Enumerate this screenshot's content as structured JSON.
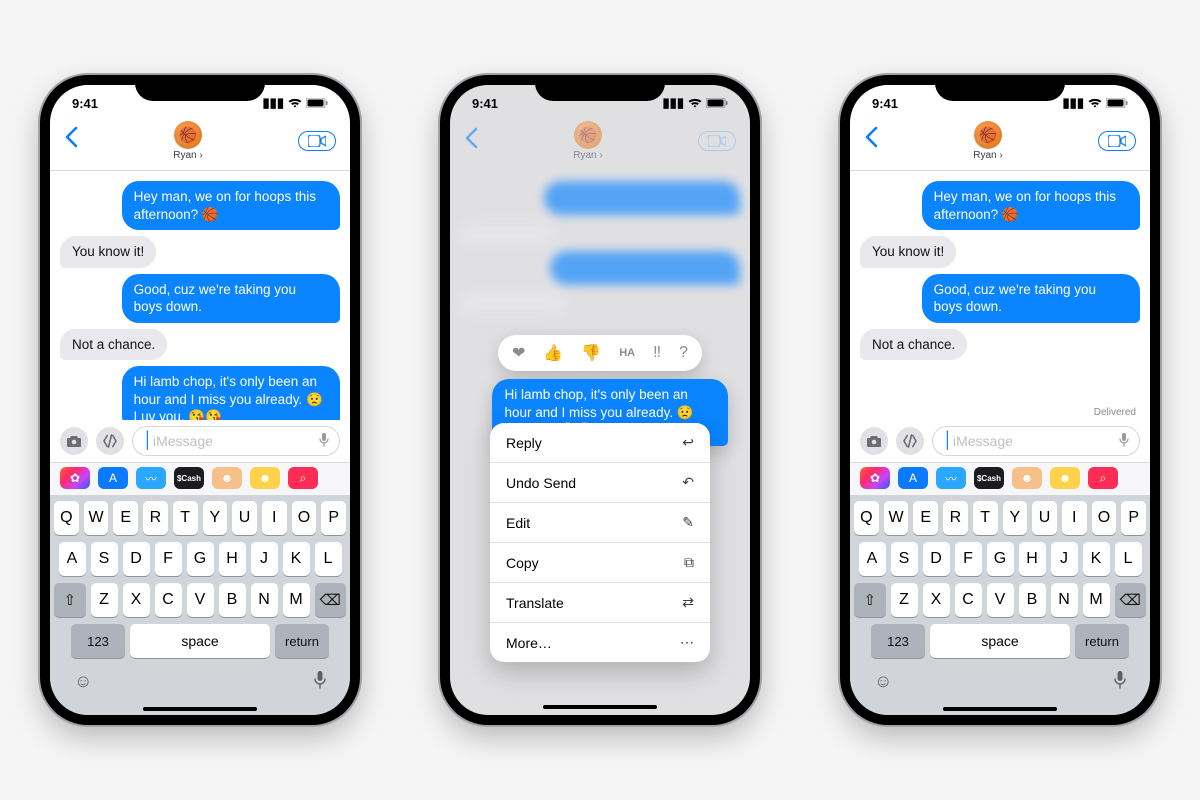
{
  "status": {
    "time": "9:41"
  },
  "contact": {
    "name": "Ryan",
    "avatar_emoji": "🏀"
  },
  "messages": [
    {
      "side": "sent",
      "text": "Hey man, we on for hoops this afternoon? 🏀"
    },
    {
      "side": "recv",
      "text": "You know it!"
    },
    {
      "side": "sent",
      "text": "Good, cuz we're taking you boys down."
    },
    {
      "side": "recv",
      "text": "Not a chance."
    },
    {
      "side": "sent",
      "text": "Hi lamb chop, it's only been an hour and I miss you already. 😟 Luv you. 😘😘"
    }
  ],
  "delivered_label": "Delivered",
  "focused_message": "Hi lamb chop, it's only been an hour and I miss you already. 😟 Luv you. 😘😘",
  "tapbacks": [
    "❤︎",
    "👍",
    "👎",
    "HA",
    "‼︎",
    "?"
  ],
  "context_menu": [
    {
      "label": "Reply",
      "icon": "↩︎"
    },
    {
      "label": "Undo Send",
      "icon": "↶"
    },
    {
      "label": "Edit",
      "icon": "✎"
    },
    {
      "label": "Copy",
      "icon": "⧉"
    },
    {
      "label": "Translate",
      "icon": "⇄"
    },
    {
      "label": "More…",
      "icon": "⋯"
    }
  ],
  "input": {
    "placeholder": "iMessage"
  },
  "app_strip": [
    {
      "name": "photos",
      "bg": "linear-gradient(135deg,#ff5e3a,#ff2a68,#c644fc,#1d62f0)",
      "glyph": "✿"
    },
    {
      "name": "appstore",
      "bg": "#0a7aff",
      "glyph": "A"
    },
    {
      "name": "audio",
      "bg": "#2aa7ff",
      "glyph": "〰"
    },
    {
      "name": "cash",
      "bg": "#1c1c1e",
      "glyph": "$"
    },
    {
      "name": "memoji1",
      "bg": "#f5c089",
      "glyph": "☻"
    },
    {
      "name": "memoji2",
      "bg": "#ffd24d",
      "glyph": "☻"
    },
    {
      "name": "search",
      "bg": "#ff2d55",
      "glyph": "⌕"
    }
  ],
  "keyboard": {
    "rows": [
      [
        "Q",
        "W",
        "E",
        "R",
        "T",
        "Y",
        "U",
        "I",
        "O",
        "P"
      ],
      [
        "A",
        "S",
        "D",
        "F",
        "G",
        "H",
        "J",
        "K",
        "L"
      ],
      [
        "Z",
        "X",
        "C",
        "V",
        "B",
        "N",
        "M"
      ]
    ],
    "shift": "⇧",
    "backspace": "⌫",
    "numbers": "123",
    "space": "space",
    "return": "return",
    "emoji": "☺",
    "mic": "🎤"
  }
}
